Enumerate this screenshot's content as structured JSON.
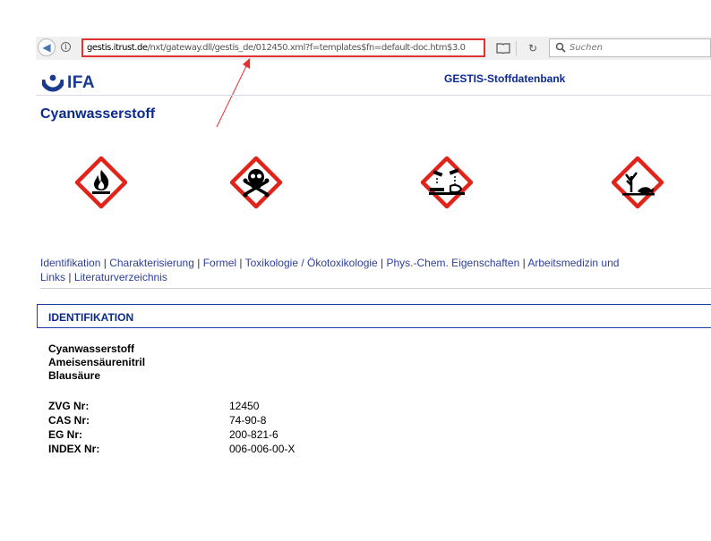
{
  "browser": {
    "url_host": "gestis.itrust.de",
    "url_path": "/nxt/gateway.dll/gestis_de/012450.xml?f=templates$fn=default-doc.htm$3.0",
    "search_placeholder": "Suchen"
  },
  "header": {
    "logo_text": "IFA",
    "database_title": "GESTIS-Stoffdatenbank"
  },
  "substance": {
    "title": "Cyanwasserstoff"
  },
  "pictograms": [
    {
      "name": "flame-icon"
    },
    {
      "name": "skull-crossbones-icon"
    },
    {
      "name": "corrosion-icon"
    },
    {
      "name": "environment-icon"
    }
  ],
  "nav": {
    "line1": [
      "Identifikation",
      "Charakterisierung",
      "Formel",
      "Toxikologie / Ökotoxikologie",
      "Phys.-Chem. Eigenschaften",
      "Arbeitsmedizin und"
    ],
    "line2": [
      "Links",
      "Literaturverzeichnis"
    ],
    "separator": " | "
  },
  "section": {
    "title": "IDENTIFIKATION",
    "names": [
      "Cyanwasserstoff",
      "Ameisensäurenitril",
      "Blausäure"
    ],
    "fields": [
      {
        "label": "ZVG Nr:",
        "value": "12450"
      },
      {
        "label": "CAS Nr:",
        "value": "74-90-8"
      },
      {
        "label": "EG Nr:",
        "value": "200-821-6"
      },
      {
        "label": "INDEX Nr:",
        "value": "006-006-00-X"
      }
    ]
  },
  "colors": {
    "annotation_red": "#e0322f",
    "heading_blue": "#0a2a8c",
    "link_blue": "#2e3f9a",
    "ghs_red": "#e2231a"
  }
}
